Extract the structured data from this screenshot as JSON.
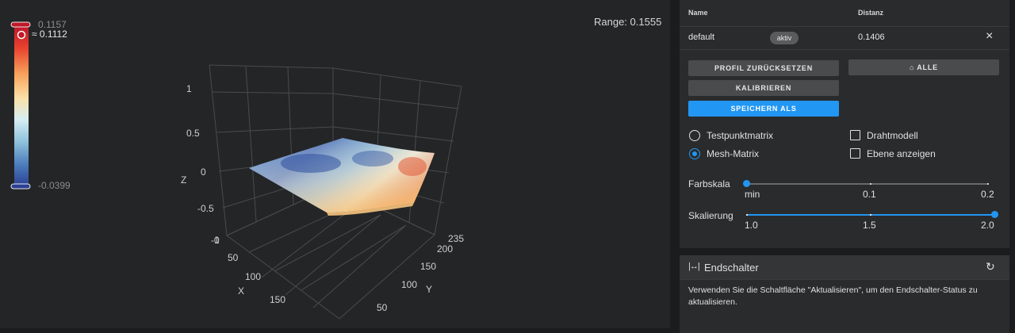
{
  "plot": {
    "range_text": "Range: 0.1555",
    "colorbar": {
      "max_label": "0.1157",
      "current_label": "≈ 0.1112",
      "min_label": "-0.0399",
      "colors": [
        "#c01729",
        "#e9442f",
        "#f7a35b",
        "#fbe1a8",
        "#d7eef2",
        "#8fc3dd",
        "#4d7fbd",
        "#2b3f94"
      ]
    },
    "z_ticks": [
      "1",
      "0.5",
      "0",
      "-0.5",
      "-1"
    ],
    "z_label": "Z",
    "x_ticks": [
      "0",
      "50",
      "100",
      "150"
    ],
    "x_label": "X",
    "y_ticks": [
      "235",
      "200",
      "150",
      "100",
      "50"
    ],
    "y_label": "Y"
  },
  "profiles": {
    "headers": {
      "name": "Name",
      "distance": "Distanz"
    },
    "rows": [
      {
        "name": "default",
        "status": "aktiv",
        "distance": "0.1406",
        "remove": "×"
      }
    ],
    "buttons": {
      "reset": "PROFIL ZURÜCKSETZEN",
      "home_all": "ALLE",
      "calibrate": "KALIBRIEREN",
      "save_as": "SPEICHERN ALS"
    },
    "options": {
      "probe_matrix": "Testpunktmatrix",
      "mesh_matrix": "Mesh-Matrix",
      "wireframe": "Drahtmodell",
      "show_plane": "Ebene anzeigen",
      "selected_matrix": "mesh_matrix",
      "wireframe_checked": false,
      "show_plane_checked": false
    },
    "color_scale": {
      "label": "Farbskala",
      "ticks": [
        "min",
        "0.1",
        "0.2"
      ],
      "value_fraction": 0
    },
    "scaling": {
      "label": "Skalierung",
      "ticks": [
        "1.0",
        "1.5",
        "2.0"
      ],
      "value": 2.0
    }
  },
  "endstops": {
    "title": "Endschalter",
    "description": "Verwenden Sie die Schaltfläche \"Aktualisieren\", um den Endschalter-Status zu aktualisieren."
  },
  "colors": {
    "accent": "#2196f3",
    "panel": "#2a2b2d",
    "background": "#1b1c1e"
  }
}
